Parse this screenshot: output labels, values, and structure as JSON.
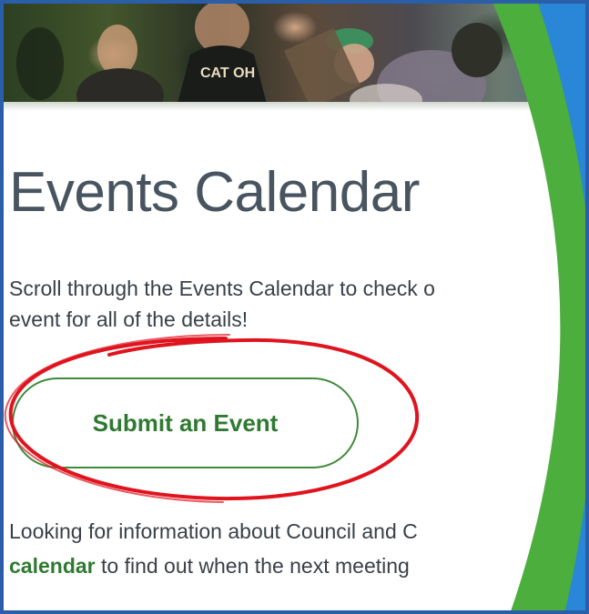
{
  "page": {
    "title": "Events Calendar",
    "intro_line1": "Scroll through the Events Calendar to check o",
    "intro_line2": "event for all of the details!",
    "submit_button": "Submit an Event",
    "info_line1": "Looking for information about Council and C",
    "info_link": "calendar",
    "info_line2_rest": " to find out when the next meeting"
  },
  "hero": {
    "shirt_text": "CAT OH"
  },
  "colors": {
    "accent_green": "#2f7a31",
    "button_border": "#3f8a3b",
    "title": "#485460",
    "body_text": "#3a4048",
    "annotation_red": "#e0141e",
    "arc_green": "#4cae3c",
    "arc_blue": "#2a86d6",
    "frame_blue": "#2a5ea8"
  },
  "icons": {
    "hero": "crowd-photo",
    "annotation": "red-hand-drawn-ellipse"
  }
}
